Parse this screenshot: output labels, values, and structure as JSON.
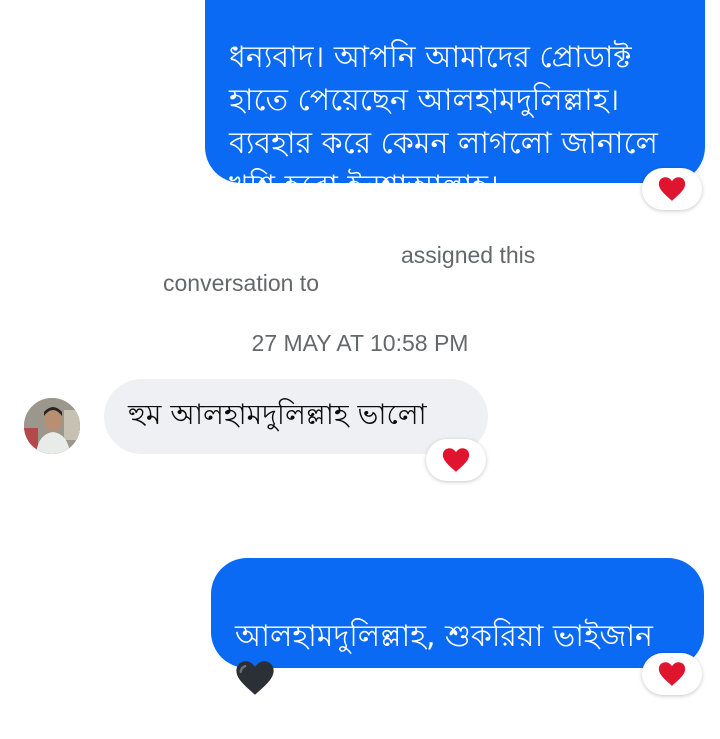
{
  "messages": [
    {
      "direction": "outgoing",
      "text": "ধন্যবাদ। আপনি আমাদের প্রোডাক্ট\nহাতে পেয়েছেন আলহামদুলিল্লাহ।\nব্যবহার করে কেমন লাগলো জানালে\nখুশি হবো ইনশাআল্লাহ।",
      "reaction": "red-heart"
    },
    {
      "direction": "incoming",
      "text": "হুম আলহামদুলিল্লাহ ভালো",
      "reaction": "red-heart"
    },
    {
      "direction": "outgoing",
      "text": "আলহামদুলিল্লাহ, শুকরিয়া ভাইজান",
      "trailing_emoji": "black-heart",
      "reaction": "red-heart"
    }
  ],
  "system_notice": {
    "line1": "assigned this",
    "line2": "conversation to"
  },
  "timestamp": "27 MAY AT 10:58 PM",
  "colors": {
    "outgoing_bubble": "#0a6af3",
    "incoming_bubble": "#eef0f3",
    "meta_text": "#65676b",
    "reaction_heart": "#e0142e",
    "black_heart": "#2b2f36"
  }
}
